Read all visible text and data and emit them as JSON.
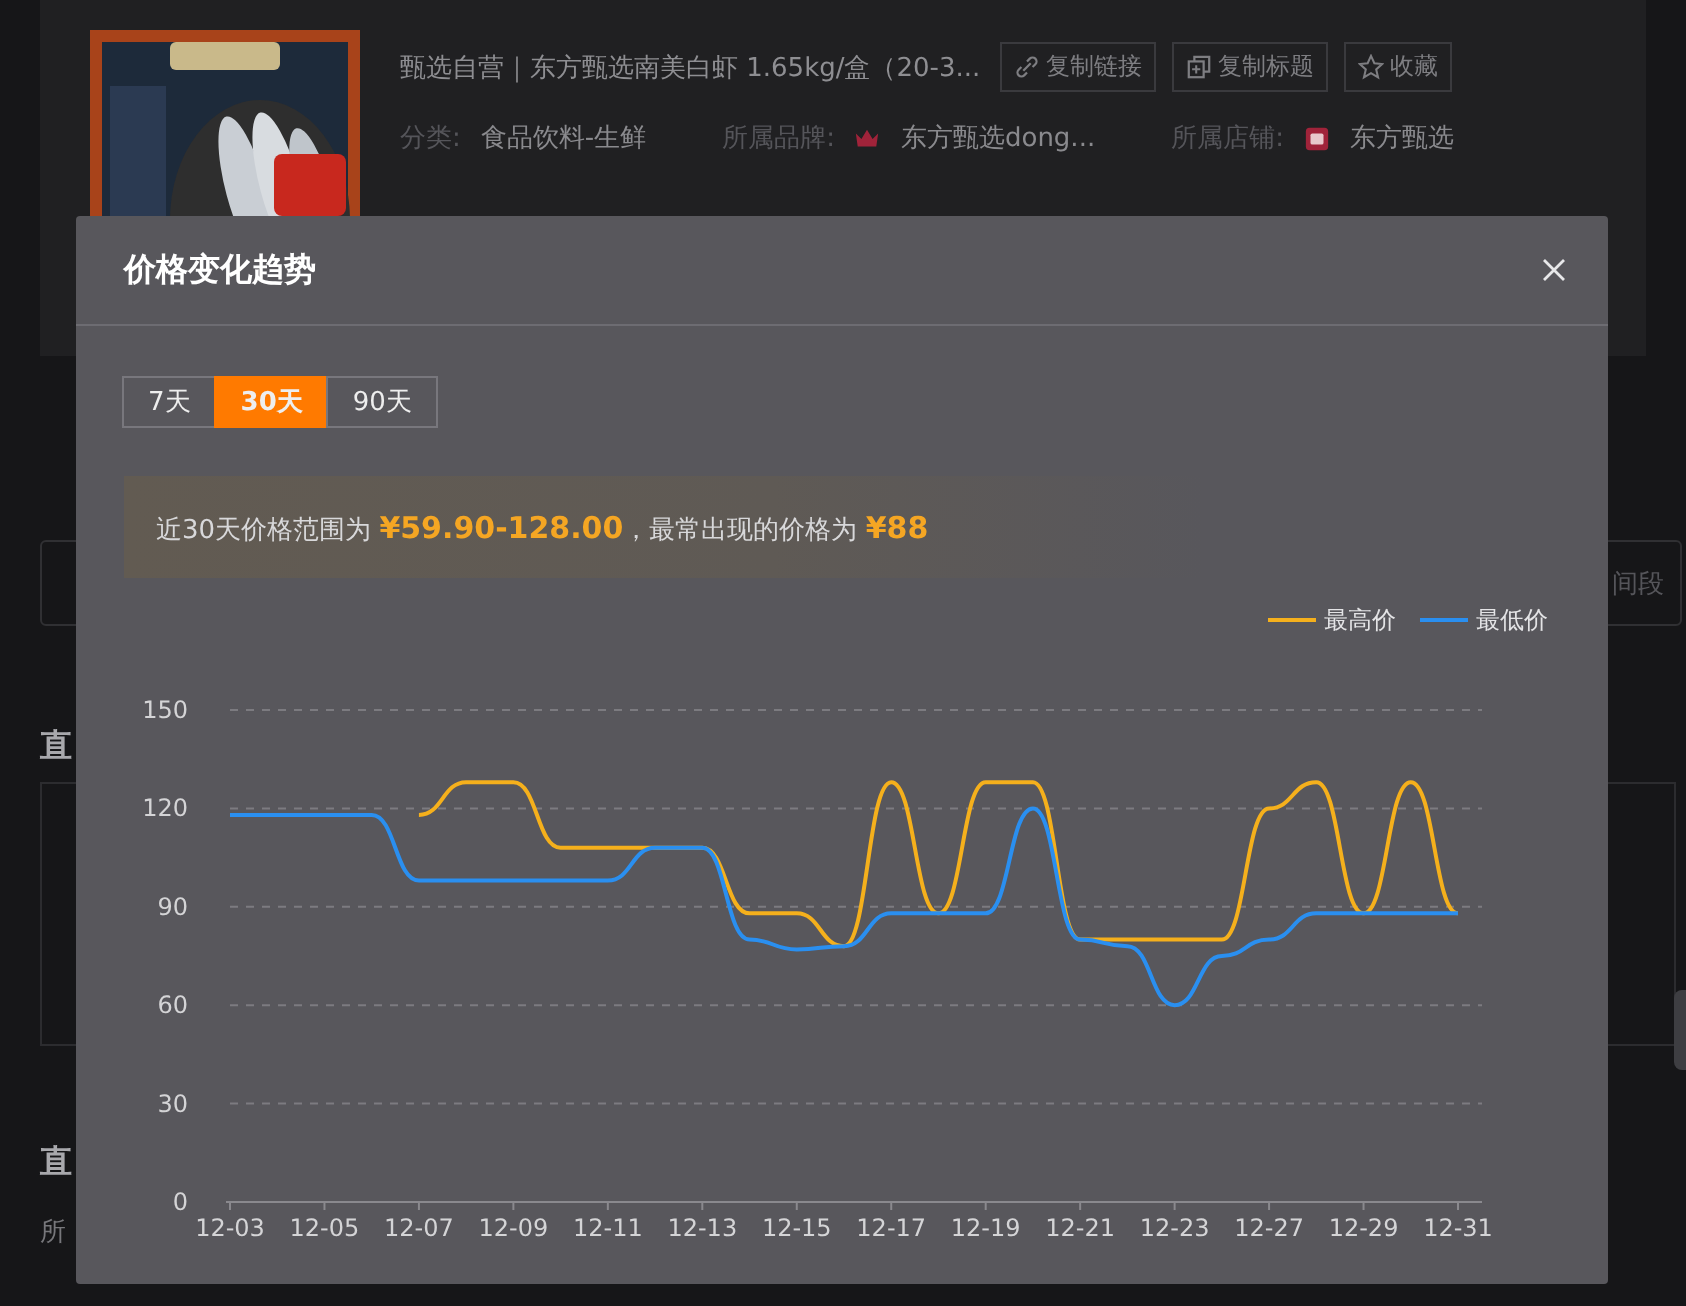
{
  "product": {
    "title": "甄选自营｜东方甄选南美白虾 1.65kg/盒（20-3...",
    "actions": [
      {
        "label": "复制链接"
      },
      {
        "label": "复制标题"
      },
      {
        "label": "收藏"
      }
    ],
    "meta": [
      {
        "label": "分类:",
        "value": "食品饮料-生鲜"
      },
      {
        "label": "所属品牌:",
        "value": "东方甄选dong..."
      },
      {
        "label": "所属店铺:",
        "value": "东方甄选"
      }
    ]
  },
  "time_field": {
    "placeholder": "间段"
  },
  "section_1": {
    "heading": "直"
  },
  "section_2": {
    "heading": "直",
    "text": "所"
  },
  "modal": {
    "title": "价格变化趋势",
    "tabs": [
      {
        "label": "7天",
        "selected": false
      },
      {
        "label": "30天",
        "selected": true
      },
      {
        "label": "90天",
        "selected": false
      }
    ],
    "summary": "近30天价格范围为 **¥59.90-128.00**，最常出现的价格为 **¥88**",
    "chart_data": {
      "type": "line",
      "categories": [
        "12-03",
        null,
        "12-05",
        null,
        "12-07",
        null,
        "12-09",
        null,
        "12-11",
        null,
        "12-13",
        null,
        "12-15",
        null,
        "12-17",
        null,
        "12-19",
        null,
        "12-21",
        null,
        "12-23",
        null,
        "12-27",
        null,
        "12-29",
        null,
        "12-31"
      ],
      "ylim": [
        0,
        150
      ],
      "yticks": [
        0,
        30,
        60,
        90,
        120,
        150
      ],
      "grid": true,
      "legend": "top-right",
      "series": [
        {
          "name": "最高价",
          "color": "#f5b01c",
          "values": [
            null,
            null,
            null,
            null,
            118,
            128,
            128,
            108,
            108,
            108,
            108,
            88,
            88,
            78,
            128,
            88,
            128,
            128,
            80,
            80,
            80,
            80,
            120,
            128,
            88,
            128,
            88
          ]
        },
        {
          "name": "最低价",
          "color": "#2a8ff0",
          "values": [
            118,
            118,
            118,
            118,
            98,
            98,
            98,
            98,
            98,
            108,
            108,
            80,
            77,
            78,
            88,
            88,
            88,
            120,
            80,
            78,
            60,
            75,
            80,
            88,
            88,
            88,
            88
          ]
        }
      ]
    }
  }
}
